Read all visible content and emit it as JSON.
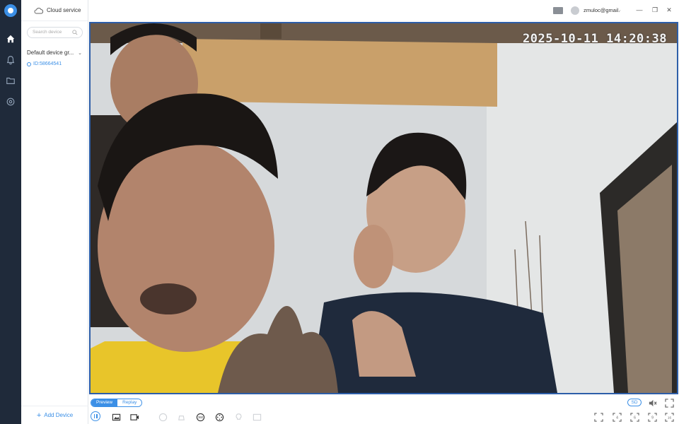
{
  "app": {
    "cloud_service_label": "Cloud service",
    "user_email": "zmuloc@gmail.c"
  },
  "sidebar": {
    "search_placeholder": "Search device",
    "group_label": "Default device gr...",
    "device_label": "ID:58664541",
    "add_device_label": "Add Device"
  },
  "video": {
    "timestamp": "2025-10-11 14:20:38"
  },
  "toolbar": {
    "preview_tab": "Preview",
    "replay_tab": "Replay",
    "quality_label": "SD",
    "split_labels": [
      "4",
      "6",
      "9",
      "16"
    ]
  },
  "colors": {
    "accent": "#3b8fe6",
    "rail_bg": "#1f2a3a",
    "video_border": "#2d5ea8"
  }
}
